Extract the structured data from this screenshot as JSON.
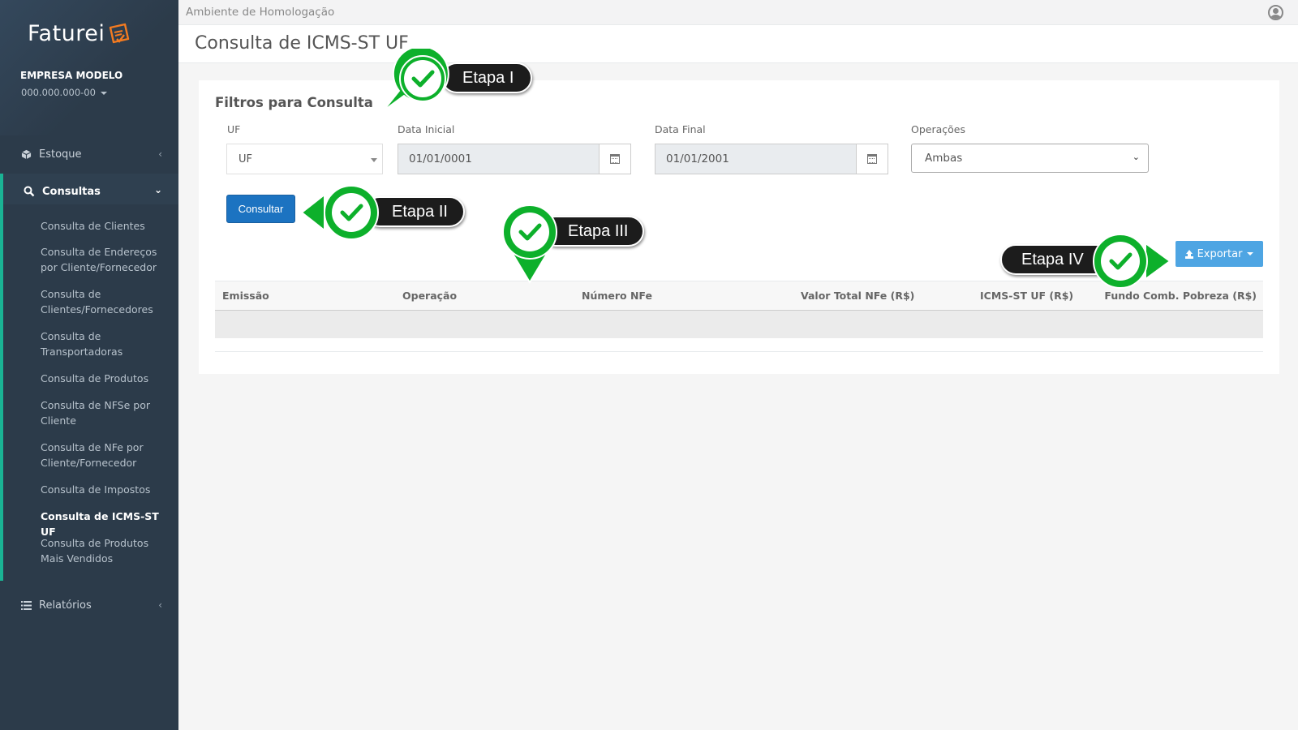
{
  "brand": {
    "logo_text": "Faturei"
  },
  "company": {
    "name": "EMPRESA MODELO",
    "cnpj": "000.000.000-00"
  },
  "sidebar": {
    "items": [
      {
        "label": "Estoque",
        "icon": "cube-icon"
      },
      {
        "label": "Consultas",
        "icon": "search-icon"
      },
      {
        "label": "Relatórios",
        "icon": "list-icon"
      }
    ],
    "submenu": [
      {
        "label": "Consulta de Clientes"
      },
      {
        "label": "Consulta de Endereços por Cliente/Fornecedor"
      },
      {
        "label": "Consulta de Clientes/Fornecedores"
      },
      {
        "label": "Consulta de Transportadoras"
      },
      {
        "label": "Consulta de Produtos"
      },
      {
        "label": "Consulta de NFSe por Cliente"
      },
      {
        "label": "Consulta de NFe por Cliente/Fornecedor"
      },
      {
        "label": "Consulta de Impostos"
      },
      {
        "label": "Consulta de ICMS-ST UF"
      },
      {
        "label": "Consulta de Produtos Mais Vendidos"
      }
    ]
  },
  "topbar": {
    "environment": "Ambiente de Homologação",
    "user_icon": "user-circle-icon"
  },
  "page": {
    "title": "Consulta de ICMS-ST UF"
  },
  "filters": {
    "title": "Filtros para Consulta",
    "uf": {
      "label": "UF",
      "value": "UF"
    },
    "data_inicial": {
      "label": "Data Inicial",
      "value": "01/01/0001"
    },
    "data_final": {
      "label": "Data Final",
      "value": "01/01/2001"
    },
    "operacoes": {
      "label": "Operações",
      "value": "Ambas"
    },
    "consultar_label": "Consultar"
  },
  "toolbar": {
    "exportar_label": "Exportar"
  },
  "table": {
    "columns": [
      "Emissão",
      "Operação",
      "Número NFe",
      "Valor Total NFe (R$)",
      "ICMS-ST UF (R$)",
      "Fundo Comb. Pobreza (R$)"
    ]
  },
  "steps": [
    {
      "label": "Etapa I"
    },
    {
      "label": "Etapa II"
    },
    {
      "label": "Etapa III"
    },
    {
      "label": "Etapa IV"
    }
  ],
  "colors": {
    "sidebar": "#2c3b4a",
    "accent": "#1ab394",
    "primary_button": "#1c73c1",
    "export_button": "#4ea5e3",
    "step_green": "#0db02b",
    "step_pill": "#1c1c1c"
  }
}
